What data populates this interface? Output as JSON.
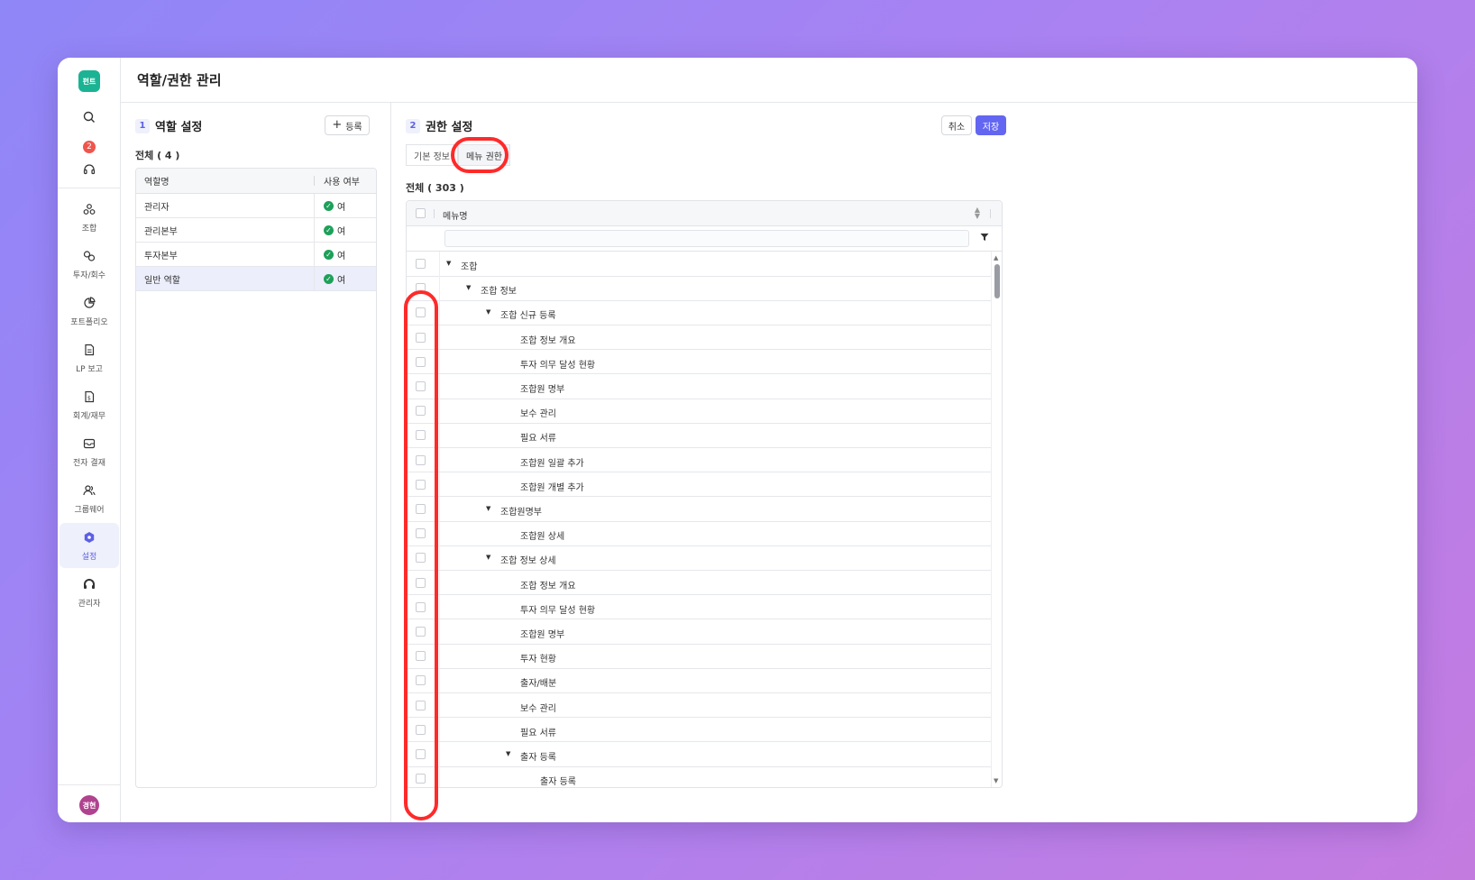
{
  "app": {
    "logo_text": "펀트"
  },
  "header": {
    "title": "역할/권한 관리"
  },
  "sidebar": {
    "notification_count": "2",
    "items": [
      {
        "label": "조합",
        "icon": "fund-icon"
      },
      {
        "label": "투자/회수",
        "icon": "invest-icon"
      },
      {
        "label": "포트폴리오",
        "icon": "portfolio-icon"
      },
      {
        "label": "LP 보고",
        "icon": "report-icon"
      },
      {
        "label": "회계/재무",
        "icon": "accounting-icon"
      },
      {
        "label": "전자 결재",
        "icon": "approval-icon"
      },
      {
        "label": "그룹웨어",
        "icon": "groupware-icon"
      },
      {
        "label": "설정",
        "icon": "settings-icon"
      },
      {
        "label": "관리자",
        "icon": "admin-icon"
      }
    ],
    "active": "설정",
    "avatar": "경현"
  },
  "roles": {
    "step": "1",
    "title": "역할 설정",
    "add_button": "등록",
    "count_label": "전체 ( 4 )",
    "columns": [
      "역할명",
      "사용 여부"
    ],
    "rows": [
      {
        "name": "관리자",
        "use": "여"
      },
      {
        "name": "관리본부",
        "use": "여"
      },
      {
        "name": "투자본부",
        "use": "여"
      },
      {
        "name": "일반 역할",
        "use": "여"
      }
    ],
    "selected_index": 3
  },
  "permissions": {
    "step": "2",
    "title": "권한 설정",
    "cancel_button": "취소",
    "save_button": "저장",
    "tabs": [
      "기본 정보",
      "메뉴 권한"
    ],
    "active_tab": "메뉴 권한",
    "count_label": "전체 ( 303 )",
    "column": "메뉴명",
    "filter_placeholder": "",
    "tree": [
      {
        "label": "조합",
        "level": 0,
        "expandable": true
      },
      {
        "label": "조합 정보",
        "level": 1,
        "expandable": true
      },
      {
        "label": "조합 신규 등록",
        "level": 2,
        "expandable": true
      },
      {
        "label": "조합 정보 개요",
        "level": 3,
        "expandable": false
      },
      {
        "label": "투자 의무 달성 현황",
        "level": 3,
        "expandable": false
      },
      {
        "label": "조합원 명부",
        "level": 3,
        "expandable": false
      },
      {
        "label": "보수 관리",
        "level": 3,
        "expandable": false
      },
      {
        "label": "필요 서류",
        "level": 3,
        "expandable": false
      },
      {
        "label": "조합원 일괄 추가",
        "level": 3,
        "expandable": false
      },
      {
        "label": "조합원 개별 추가",
        "level": 3,
        "expandable": false
      },
      {
        "label": "조합원명부",
        "level": 2,
        "expandable": true
      },
      {
        "label": "조합원 상세",
        "level": 3,
        "expandable": false
      },
      {
        "label": "조합 정보 상세",
        "level": 2,
        "expandable": true
      },
      {
        "label": "조합 정보 개요",
        "level": 3,
        "expandable": false
      },
      {
        "label": "투자 의무 달성 현황",
        "level": 3,
        "expandable": false
      },
      {
        "label": "조합원 명부",
        "level": 3,
        "expandable": false
      },
      {
        "label": "투자 현황",
        "level": 3,
        "expandable": false
      },
      {
        "label": "출자/배분",
        "level": 3,
        "expandable": false
      },
      {
        "label": "보수 관리",
        "level": 3,
        "expandable": false
      },
      {
        "label": "필요 서류",
        "level": 3,
        "expandable": false
      },
      {
        "label": "출자 등록",
        "level": 3,
        "expandable": true
      },
      {
        "label": "출자 등록",
        "level": 4,
        "expandable": false
      }
    ]
  },
  "colors": {
    "accent": "#6366f1",
    "highlight": "#ff2a2a",
    "success": "#1ea05a",
    "logo": "#1ab394"
  }
}
